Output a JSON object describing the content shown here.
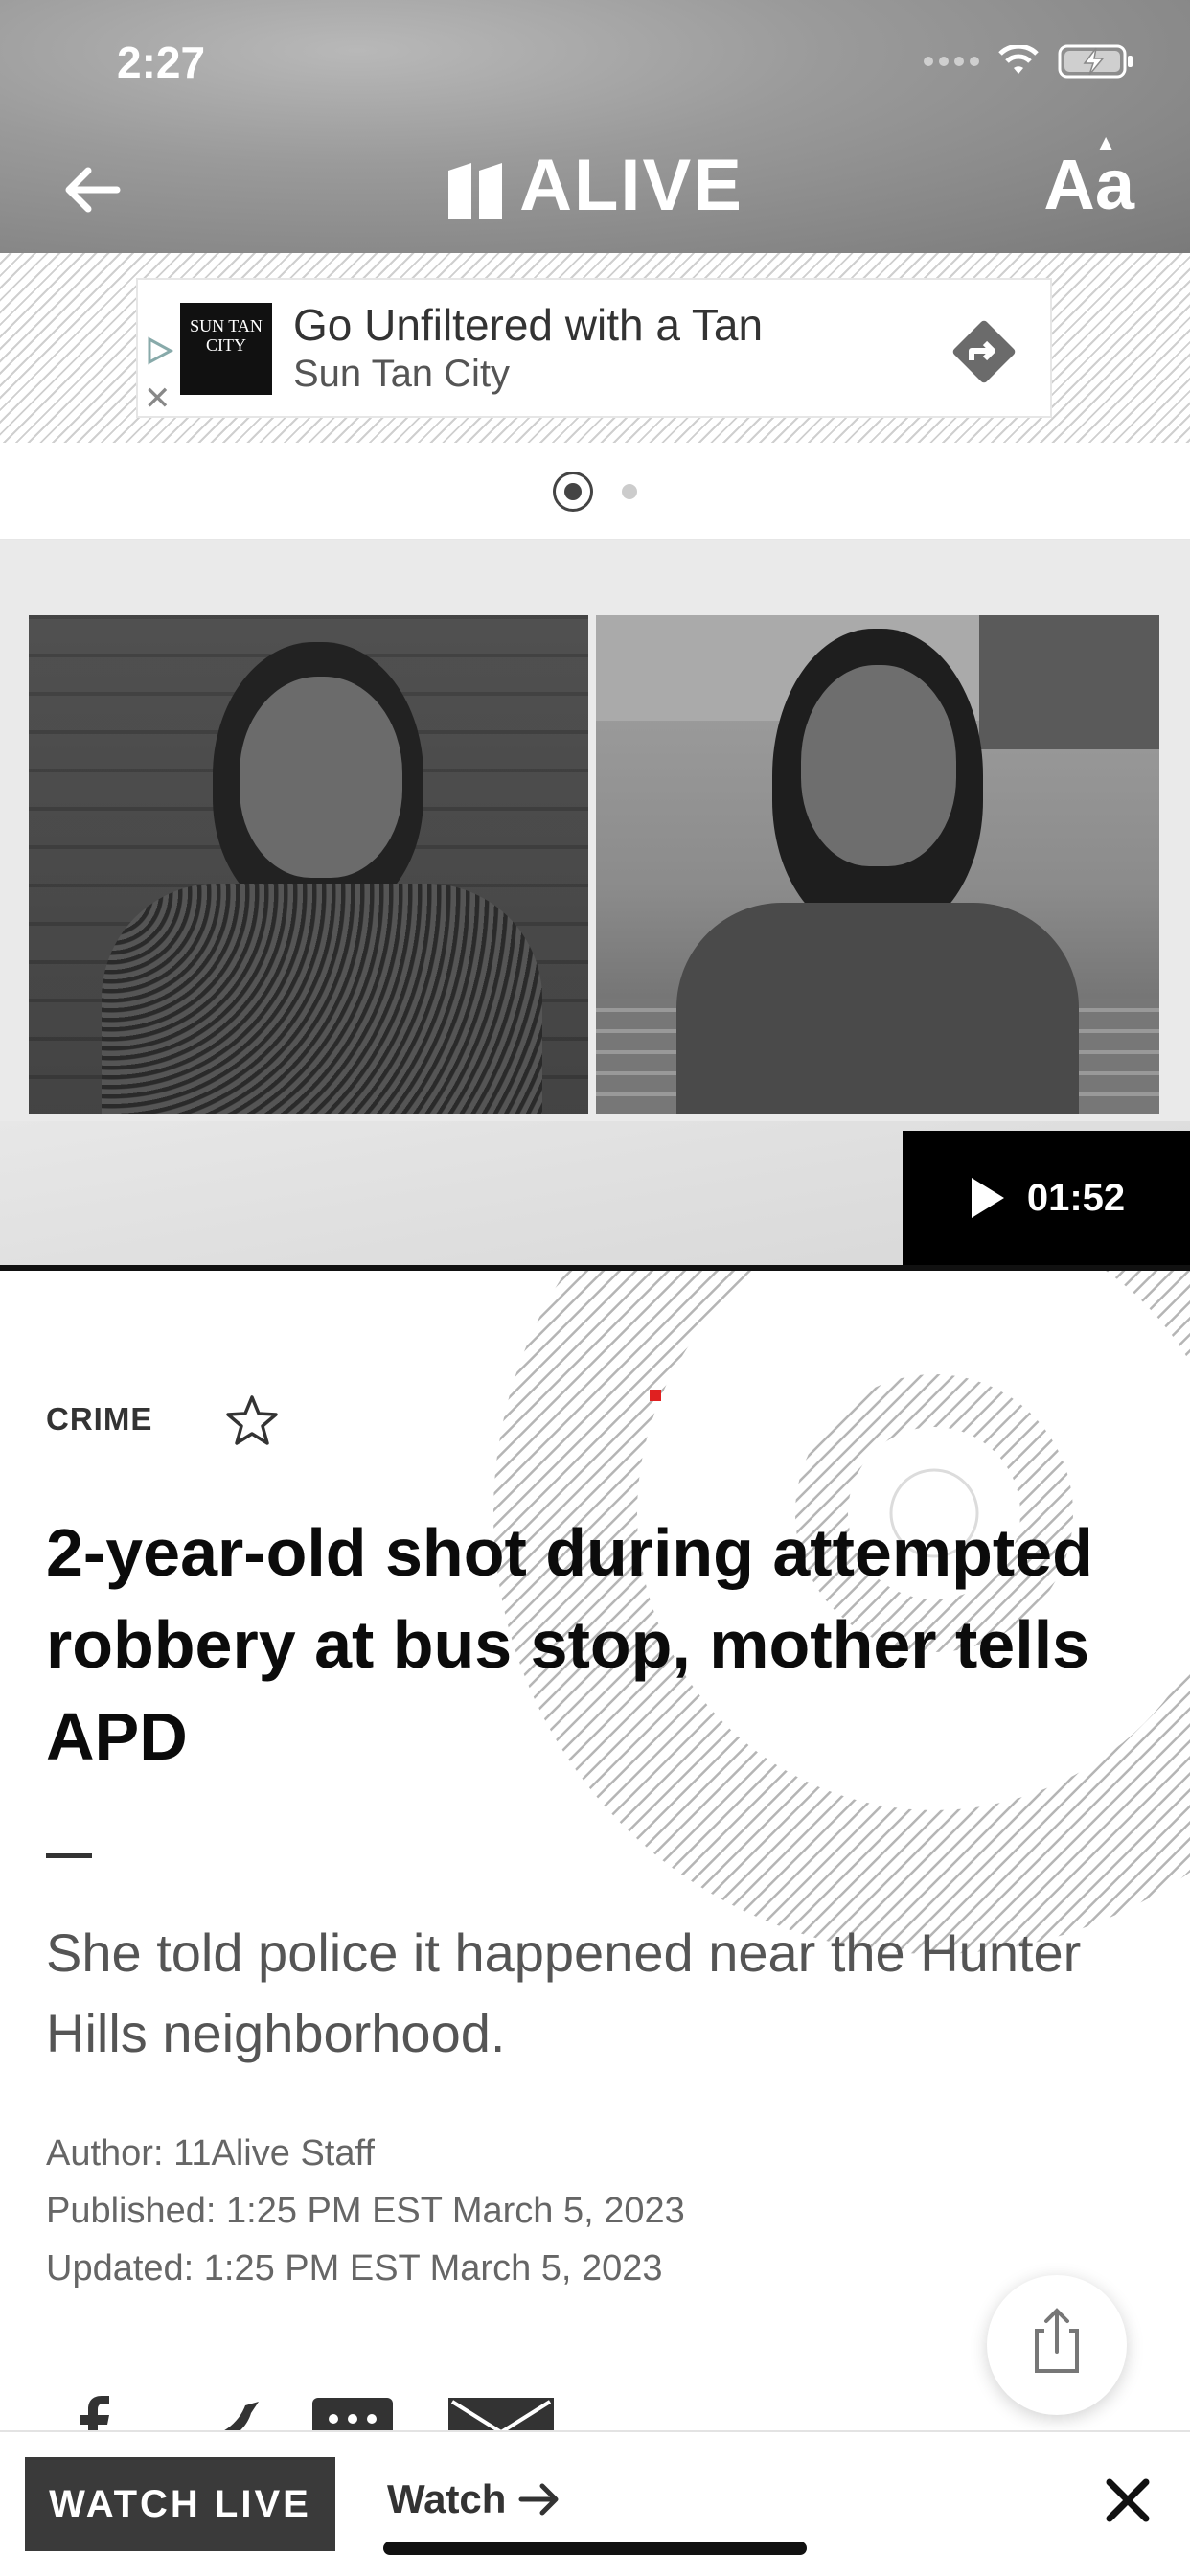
{
  "status_bar": {
    "time": "2:27"
  },
  "header": {
    "brand": "ALIVE",
    "text_size_label": "Aa"
  },
  "ad": {
    "logo_text": "SUN TAN CITY",
    "title": "Go Unfiltered with a Tan",
    "advertiser": "Sun Tan City"
  },
  "video": {
    "duration": "01:52"
  },
  "article": {
    "category": "CRIME",
    "headline": "2-year-old shot during attempted robbery at bus stop, mother tells APD",
    "summary": "She told police it happened near the Hunter Hills neighborhood.",
    "author": "Author: 11Alive Staff",
    "published": "Published: 1:25 PM EST March 5, 2023",
    "updated": "Updated: 1:25 PM EST March 5, 2023"
  },
  "bottom_bar": {
    "watch_live": "WATCH LIVE",
    "watch_link": "Watch"
  }
}
